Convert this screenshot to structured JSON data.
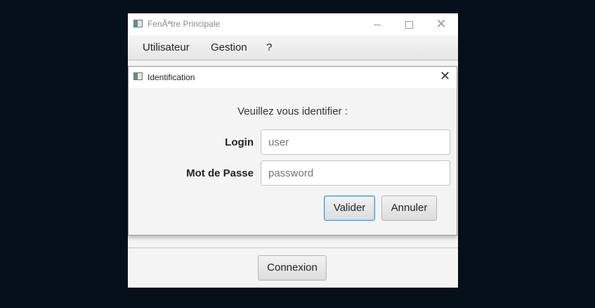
{
  "main_window": {
    "title": "FenÃªtre Principale",
    "menu": [
      "Utilisateur",
      "Gestion",
      "?"
    ],
    "connexion_button": "Connexion"
  },
  "dialog": {
    "title": "Identification",
    "prompt": "Veuillez vous identifier :",
    "login_label": "Login",
    "login_placeholder": "user",
    "password_label": "Mot de Passe",
    "password_placeholder": "password",
    "validate_button": "Valider",
    "cancel_button": "Annuler"
  }
}
